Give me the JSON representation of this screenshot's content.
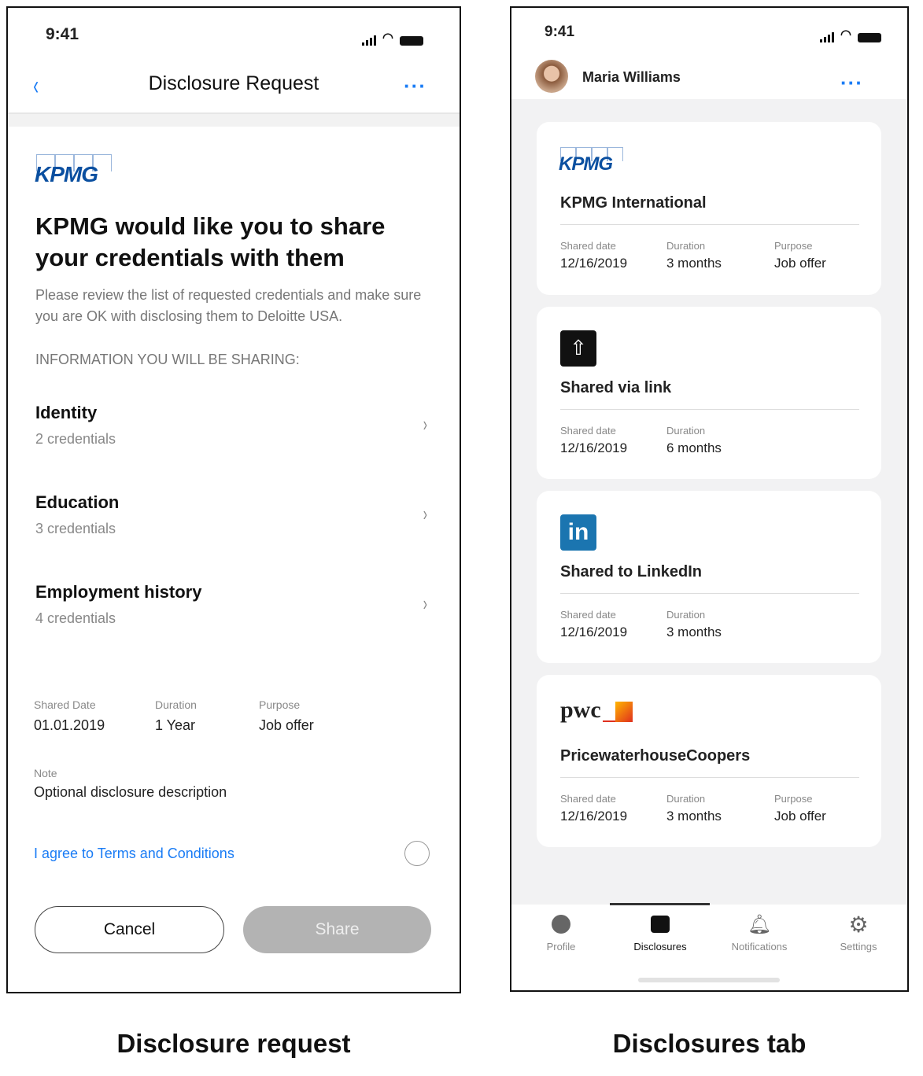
{
  "left": {
    "status_time": "9:41",
    "nav_title": "Disclosure Request",
    "logo": "KPMG",
    "heading": "KPMG would like you to share your credentials with them",
    "description": "Please review the list of requested credentials and make sure you are OK with disclosing them to Deloitte USA.",
    "section_label": "INFORMATION YOU WILL BE SHARING:",
    "items": [
      {
        "title": "Identity",
        "sub": "2 credentials"
      },
      {
        "title": "Education",
        "sub": "3 credentials"
      },
      {
        "title": "Employment history",
        "sub": "4 credentials"
      }
    ],
    "shared_date_label": "Shared Date",
    "shared_date": "01.01.2019",
    "duration_label": "Duration",
    "duration": "1 Year",
    "purpose_label": "Purpose",
    "purpose": "Job offer",
    "note_label": "Note",
    "note": "Optional disclosure description",
    "agree": "I agree to Terms and Conditions",
    "cancel": "Cancel",
    "share": "Share"
  },
  "right": {
    "status_time": "9:41",
    "user_name": "Maria Williams",
    "cards": [
      {
        "logo": "KPMG",
        "title": "KPMG International",
        "date_label": "Shared date",
        "date": "12/16/2019",
        "duration_label": "Duration",
        "duration": "3 months",
        "purpose_label": "Purpose",
        "purpose": "Job offer"
      },
      {
        "icon": "share-icon",
        "title": "Shared via link",
        "date_label": "Shared date",
        "date": "12/16/2019",
        "duration_label": "Duration",
        "duration": "6 months"
      },
      {
        "icon": "linkedin-icon",
        "logo": "in",
        "title": "Shared to LinkedIn",
        "date_label": "Shared date",
        "date": "12/16/2019",
        "duration_label": "Duration",
        "duration": "3 months"
      },
      {
        "logo": "pwc",
        "title": "PricewaterhouseCoopers",
        "date_label": "Shared date",
        "date": "12/16/2019",
        "duration_label": "Duration",
        "duration": "3 months",
        "purpose_label": "Purpose",
        "purpose": "Job offer"
      }
    ],
    "tabs": [
      "Profile",
      "Disclosures",
      "Notifications",
      "Settings"
    ]
  },
  "captions": {
    "left": "Disclosure request",
    "right": "Disclosures tab"
  }
}
